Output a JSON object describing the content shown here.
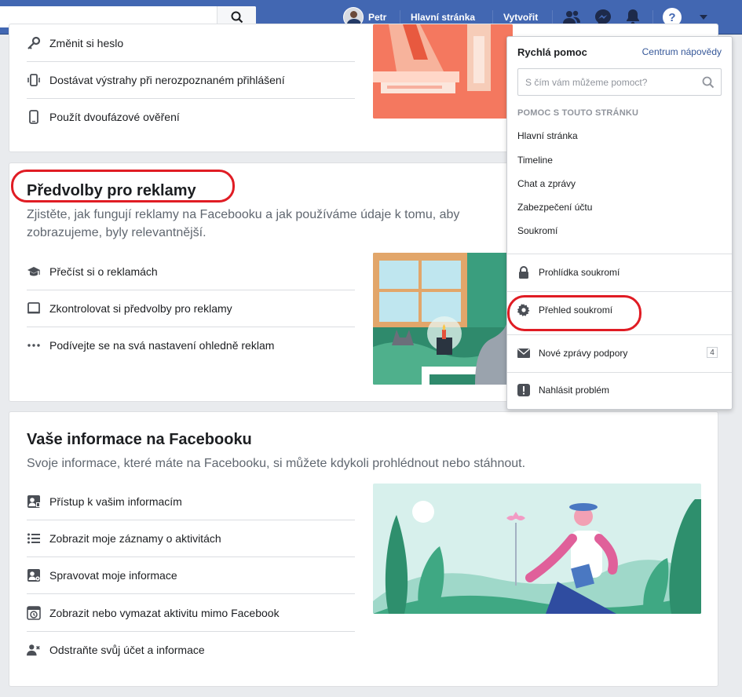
{
  "topbar": {
    "user_name": "Petr",
    "home_label": "Hlavní stránka",
    "create_label": "Vytvořit"
  },
  "security_card": {
    "items": [
      {
        "label": "Změnit si heslo",
        "icon": "key-icon"
      },
      {
        "label": "Dostávat výstrahy při nerozpoznaném přihlášení",
        "icon": "phone-vibrate-icon"
      },
      {
        "label": "Použít dvoufázové ověření",
        "icon": "mobile-phone-icon"
      }
    ]
  },
  "ads_card": {
    "title": "Předvolby pro reklamy",
    "description_line1": "Zjistěte, jak fungují reklamy na Facebooku a jak používáme údaje k tomu, aby",
    "description_line2": "zobrazujeme, byly relevantnější.",
    "items": [
      {
        "label": "Přečíst si o reklamách",
        "icon": "graduation-cap-icon"
      },
      {
        "label": "Zkontrolovat si předvolby pro reklamy",
        "icon": "laptop-icon"
      },
      {
        "label": "Podívejte se na svá nastavení ohledně reklam",
        "icon": "more-dots-icon"
      }
    ]
  },
  "info_card": {
    "title": "Vaše informace na Facebooku",
    "description": "Svoje informace, které máte na Facebooku, si můžete kdykoli prohlédnout nebo stáhnout.",
    "items": [
      {
        "label": "Přístup k vašim informacím",
        "icon": "profile-card-icon"
      },
      {
        "label": "Zobrazit moje záznamy o aktivitách",
        "icon": "list-icon"
      },
      {
        "label": "Spravovat moje informace",
        "icon": "profile-settings-icon"
      },
      {
        "label": "Zobrazit nebo vymazat aktivitu mimo Facebook",
        "icon": "history-icon"
      },
      {
        "label": "Odstraňte svůj účet a informace",
        "icon": "remove-user-icon"
      }
    ]
  },
  "help_dropdown": {
    "title": "Rychlá pomoc",
    "help_center_link": "Centrum nápovědy",
    "search_placeholder": "S čím vám můžeme pomoct?",
    "section_label": "POMOC S TOUTO STRÁNKU",
    "topics": [
      "Hlavní stránka",
      "Timeline",
      "Chat a zprávy",
      "Zabezpečení účtu",
      "Soukromí"
    ],
    "privacy_checkup": "Prohlídka soukromí",
    "privacy_shortcuts": "Přehled soukromí",
    "support_inbox": "Nové zprávy podpory",
    "support_inbox_count": "4",
    "report_problem": "Nahlásit problém"
  },
  "colors": {
    "brand_blue": "#4267b2",
    "annotation_red": "#e01c24",
    "link_blue": "#365899"
  }
}
